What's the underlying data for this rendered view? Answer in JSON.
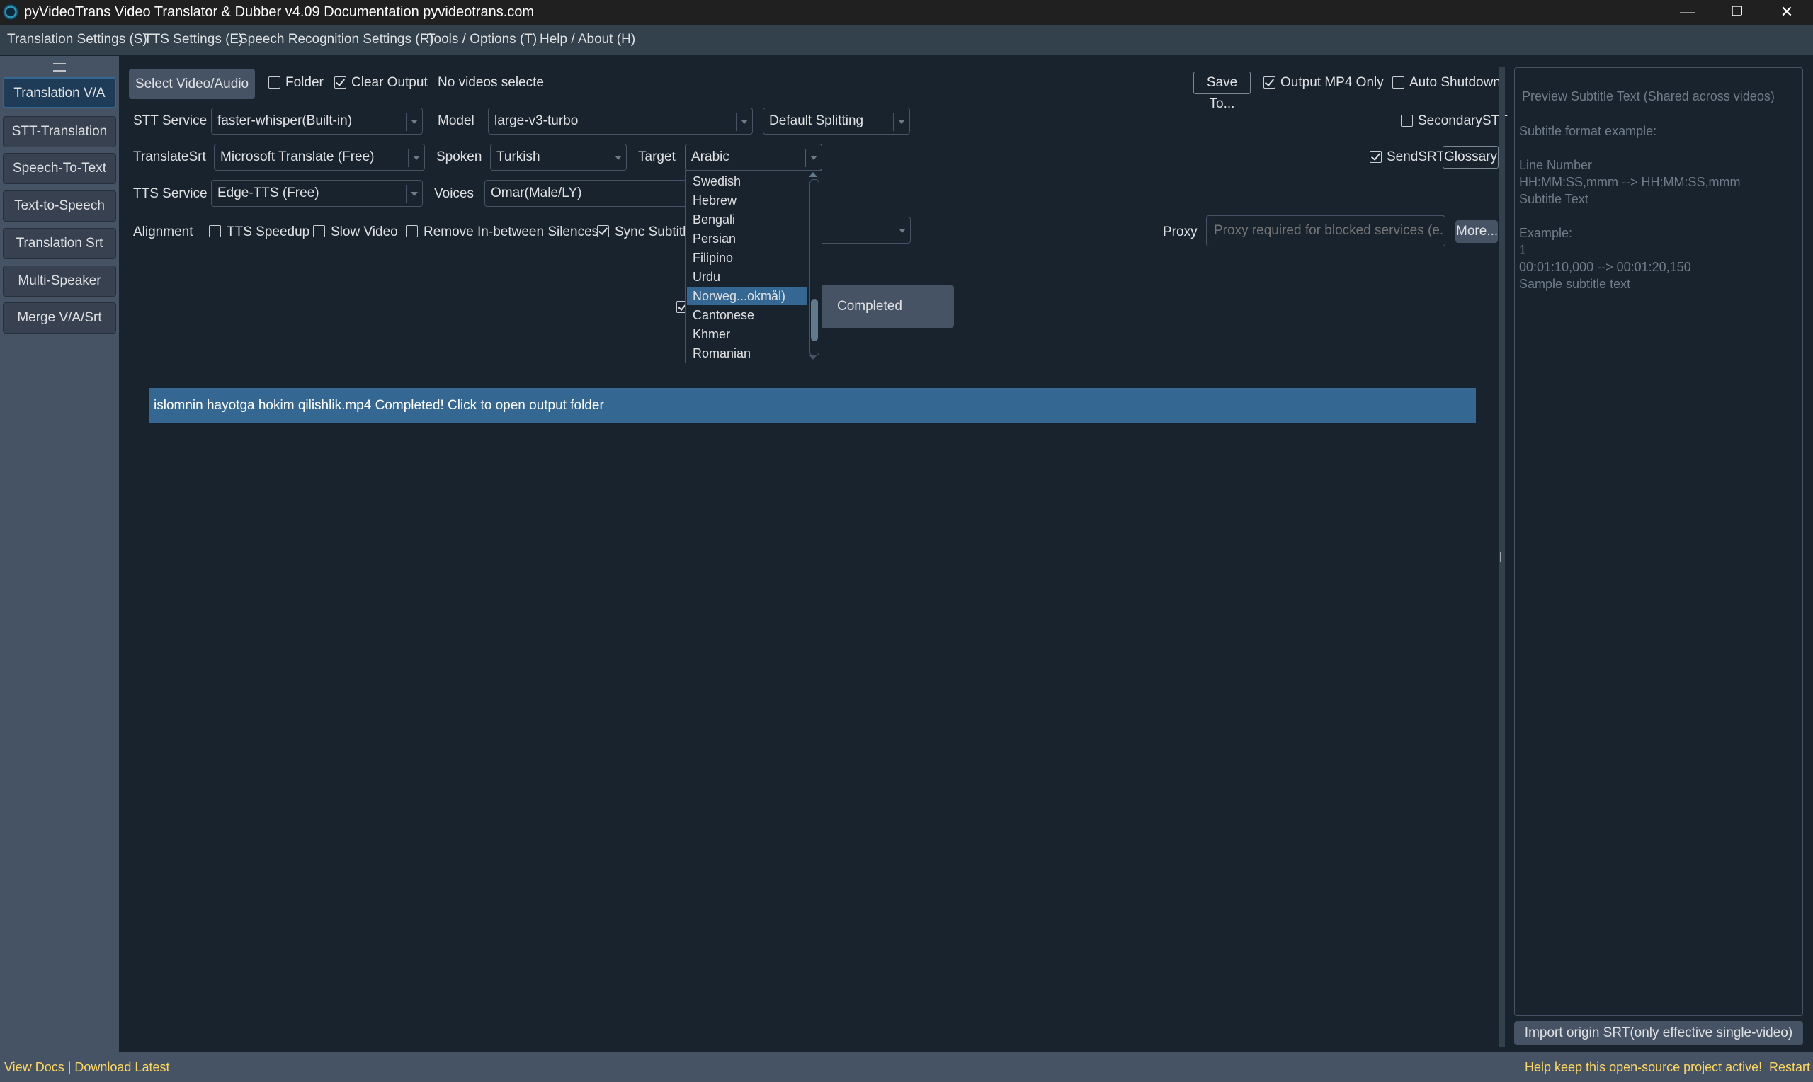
{
  "window": {
    "title": "pyVideoTrans Video Translator & Dubber v4.09 Documentation pyvideotrans.com",
    "minimize": "—",
    "maximize": "❐",
    "close": "✕"
  },
  "menubar": [
    "Translation Settings (S)",
    "TTS Settings (E)",
    "Speech Recognition Settings (R)",
    "Tools / Options (T)",
    "Help / About (H)"
  ],
  "sidebar": {
    "items": [
      "Translation V/A",
      "STT-Translation",
      "Speech-To-Text",
      "Text-to-Speech",
      "Translation Srt",
      "Multi-Speaker",
      "Merge V/A/Srt"
    ],
    "active_index": 0
  },
  "top_row": {
    "select_button": "Select Video/Audio",
    "folder_label": "Folder",
    "folder_checked": false,
    "clear_output_label": "Clear Output",
    "clear_output_checked": true,
    "status_text": "No videos selecte",
    "save_to_button": "Save To...",
    "output_mp4_label": "Output MP4 Only",
    "output_mp4_checked": true,
    "auto_shutdown_label": "Auto Shutdown",
    "auto_shutdown_checked": false
  },
  "stt_row": {
    "stt_label": "STT Service",
    "stt_value": "faster-whisper(Built-in)",
    "model_label": "Model",
    "model_value": "large-v3-turbo",
    "split_value": "Default Splitting",
    "secondary_label": "SecondarySTT",
    "secondary_checked": false
  },
  "translate_row": {
    "translate_label": "TranslateSrt",
    "translate_value": "Microsoft Translate (Free)",
    "spoken_label": "Spoken",
    "spoken_value": "Turkish",
    "target_label": "Target",
    "target_value": "Arabic",
    "sendsrt_label": "SendSRT",
    "sendsrt_checked": true,
    "glossary_button": "Glossary"
  },
  "tts_row": {
    "tts_label": "TTS Service",
    "tts_value": "Edge-TTS (Free)",
    "voices_label": "Voices",
    "voices_value": "Omar(Male/LY)"
  },
  "alignment_row": {
    "alignment_label": "Alignment",
    "tts_speedup_label": "TTS Speedup",
    "tts_speedup_checked": false,
    "slow_video_label": "Slow Video",
    "slow_video_checked": false,
    "remove_silences_label": "Remove In-between Silences",
    "remove_silences_checked": false,
    "sync_subtitle_label": "Sync Subtitle",
    "sync_subtitle_checked": true,
    "proxy_label": "Proxy",
    "proxy_placeholder": "Proxy required for blocked services (e....",
    "more_button": "More..."
  },
  "target_dropdown": {
    "options": [
      "Swedish",
      "Hebrew",
      "Bengali",
      "Persian",
      "Filipino",
      "Urdu",
      "Norweg...okmål)",
      "Cantonese",
      "Khmer",
      "Romanian"
    ],
    "selected_index": 6
  },
  "toast": {
    "text": "Completed"
  },
  "progress": {
    "text": "islomnin hayotga hokim qilishlik.mp4  Completed! Click to open output folder"
  },
  "preview": {
    "placeholder": "Preview Subtitle Text (Shared across videos)",
    "example_lines": [
      "Subtitle format example:",
      "",
      "Line Number",
      "HH:MM:SS,mmm --> HH:MM:SS,mmm",
      "Subtitle Text",
      "",
      "Example:",
      "1",
      "00:01:10,000 --> 00:01:20,150",
      "Sample subtitle text"
    ],
    "import_button": "Import origin SRT(only effective single-video)"
  },
  "statusbar": {
    "left_link": "View Docs | Download Latest",
    "right_text": "Help keep this open-source project active!",
    "restart": "Restart"
  },
  "colors": {
    "background": "#19232d",
    "panel": "#455364",
    "accent": "#346792",
    "link": "#ffd75e"
  }
}
